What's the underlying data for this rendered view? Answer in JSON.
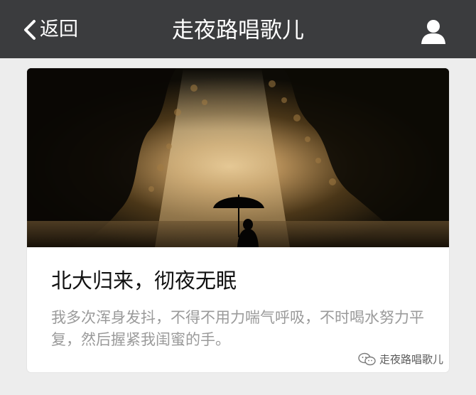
{
  "header": {
    "back_label": "返回",
    "title": "走夜路唱歌儿",
    "profile_icon": "person-icon"
  },
  "article": {
    "title": "北大归来，彻夜无眠",
    "description": "我多次浑身发抖，不得不用力喘气呼吸，不时喝水努力平复，然后握紧我闺蜜的手。",
    "watermark": "走夜路唱歌儿",
    "watermark_icon": "wechat-icon"
  },
  "colors": {
    "header_bg": "#3b3c3e",
    "page_bg": "#ededed"
  }
}
